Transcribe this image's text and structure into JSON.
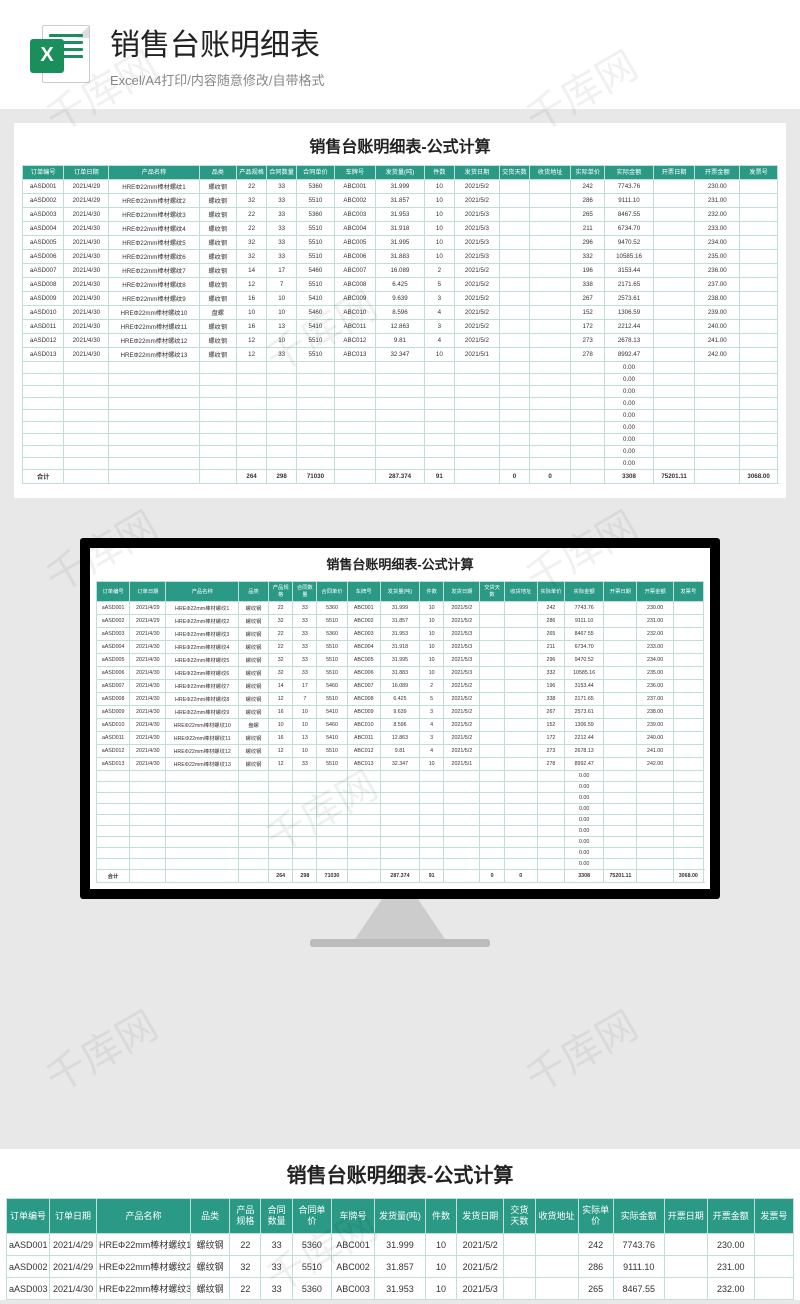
{
  "header": {
    "title": "销售台账明细表",
    "subtitle": "Excel/A4打印/内容随意修改/自带格式",
    "icon_letter": "X"
  },
  "sheet": {
    "title": "销售台账明细表-公式计算",
    "columns": [
      "订单编号",
      "订单日期",
      "产品名称",
      "品类",
      "产品规格",
      "合同数量",
      "合同单价",
      "车牌号",
      "发货量(吨)",
      "件数",
      "发货日期",
      "交货天数",
      "收货地址",
      "实际单价",
      "实际金额",
      "开票日期",
      "开票金额",
      "发票号"
    ],
    "rows": [
      [
        "aASD001",
        "2021/4/29",
        "HREΦ22mm棒材螺纹1",
        "螺纹钢",
        "22",
        "33",
        "5360",
        "ABC001",
        "31.999",
        "10",
        "2021/5/2",
        "",
        "",
        "242",
        "7743.76",
        "",
        "230.00",
        ""
      ],
      [
        "aASD002",
        "2021/4/29",
        "HREΦ22mm棒材螺纹2",
        "螺纹钢",
        "32",
        "33",
        "5510",
        "ABC002",
        "31.857",
        "10",
        "2021/5/2",
        "",
        "",
        "286",
        "9111.10",
        "",
        "231.00",
        ""
      ],
      [
        "aASD003",
        "2021/4/30",
        "HREΦ22mm棒材螺纹3",
        "螺纹钢",
        "22",
        "33",
        "5360",
        "ABC003",
        "31.953",
        "10",
        "2021/5/3",
        "",
        "",
        "265",
        "8467.55",
        "",
        "232.00",
        ""
      ],
      [
        "aASD004",
        "2021/4/30",
        "HREΦ22mm棒材螺纹4",
        "螺纹钢",
        "22",
        "33",
        "5510",
        "ABC004",
        "31.918",
        "10",
        "2021/5/3",
        "",
        "",
        "211",
        "6734.70",
        "",
        "233.00",
        ""
      ],
      [
        "aASD005",
        "2021/4/30",
        "HREΦ22mm棒材螺纹5",
        "螺纹钢",
        "32",
        "33",
        "5510",
        "ABC005",
        "31.995",
        "10",
        "2021/5/3",
        "",
        "",
        "296",
        "9470.52",
        "",
        "234.00",
        ""
      ],
      [
        "aASD006",
        "2021/4/30",
        "HREΦ22mm棒材螺纹6",
        "螺纹钢",
        "32",
        "33",
        "5510",
        "ABC006",
        "31.883",
        "10",
        "2021/5/3",
        "",
        "",
        "332",
        "10585.16",
        "",
        "235.00",
        ""
      ],
      [
        "aASD007",
        "2021/4/30",
        "HREΦ22mm棒材螺纹7",
        "螺纹钢",
        "14",
        "17",
        "5460",
        "ABC007",
        "16.089",
        "2",
        "2021/5/2",
        "",
        "",
        "196",
        "3153.44",
        "",
        "236.00",
        ""
      ],
      [
        "aASD008",
        "2021/4/30",
        "HREΦ22mm棒材螺纹8",
        "螺纹钢",
        "12",
        "7",
        "5510",
        "ABC008",
        "6.425",
        "5",
        "2021/5/2",
        "",
        "",
        "338",
        "2171.65",
        "",
        "237.00",
        ""
      ],
      [
        "aASD009",
        "2021/4/30",
        "HREΦ22mm棒材螺纹9",
        "螺纹钢",
        "16",
        "10",
        "5410",
        "ABC009",
        "9.639",
        "3",
        "2021/5/2",
        "",
        "",
        "267",
        "2573.61",
        "",
        "238.00",
        ""
      ],
      [
        "aASD010",
        "2021/4/30",
        "HREΦ22mm棒材螺纹10",
        "盘螺",
        "10",
        "10",
        "5460",
        "ABC010",
        "8.596",
        "4",
        "2021/5/2",
        "",
        "",
        "152",
        "1306.59",
        "",
        "239.00",
        ""
      ],
      [
        "aASD011",
        "2021/4/30",
        "HREΦ22mm棒材螺纹11",
        "螺纹钢",
        "16",
        "13",
        "5410",
        "ABC011",
        "12.863",
        "3",
        "2021/5/2",
        "",
        "",
        "172",
        "2212.44",
        "",
        "240.00",
        ""
      ],
      [
        "aASD012",
        "2021/4/30",
        "HREΦ22mm棒材螺纹12",
        "螺纹钢",
        "12",
        "10",
        "5510",
        "ABC012",
        "9.81",
        "4",
        "2021/5/2",
        "",
        "",
        "273",
        "2678.13",
        "",
        "241.00",
        ""
      ],
      [
        "aASD013",
        "2021/4/30",
        "HREΦ22mm棒材螺纹13",
        "螺纹钢",
        "12",
        "33",
        "5510",
        "ABC013",
        "32.347",
        "10",
        "2021/5/1",
        "",
        "",
        "278",
        "8992.47",
        "",
        "242.00",
        ""
      ]
    ],
    "zero_rows": 9,
    "zero_value": "0.00",
    "totals_label": "合计",
    "totals": [
      "",
      "",
      "",
      "",
      "264",
      "298",
      "71030",
      "",
      "287.374",
      "91",
      "",
      "0",
      "0",
      "",
      "3308",
      "75201.11",
      "",
      "3068.00",
      ""
    ]
  },
  "strip_rows_count": 3,
  "watermark_text": "千库网"
}
